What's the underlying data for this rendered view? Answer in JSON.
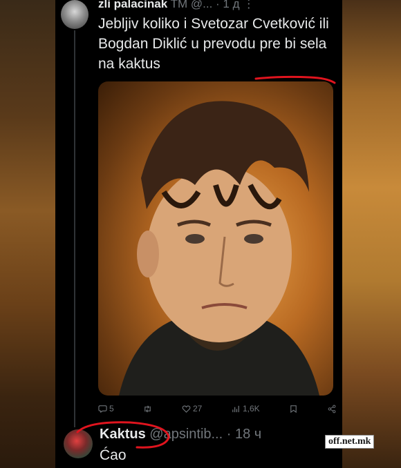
{
  "tweet": {
    "author_name": "zli palacinak",
    "meta": "TM @... · 1 д",
    "text": "Jebljiv koliko i Svetozar Cvetković ili Bogdan Diklić u prevodu pre bi sela na kaktus",
    "actions": {
      "replies": "5",
      "likes": "27",
      "views": "1,6K"
    }
  },
  "reply": {
    "author_name": "Kaktus",
    "meta": "@apsintib... · 18 ч",
    "text": "Ćao"
  },
  "watermark": "off.net.mk",
  "colors": {
    "annotation": "#e0141e",
    "text_primary": "#e7e9ea",
    "text_secondary": "#71767b",
    "background": "#000000"
  }
}
